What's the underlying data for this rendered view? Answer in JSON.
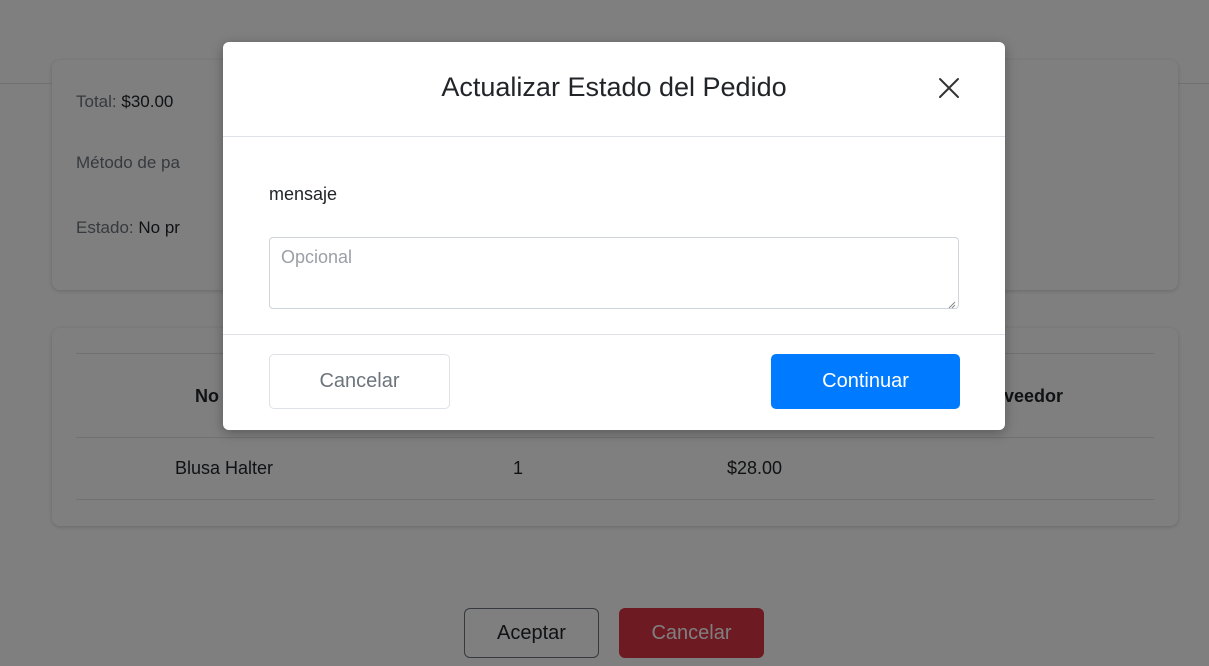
{
  "order_info": {
    "total_label": "Total:",
    "total_value": "$30.00",
    "payment_label": "Método de pa",
    "status_label": "Estado:",
    "status_value": "No pr"
  },
  "products_table": {
    "columns": [
      {
        "label": "No"
      },
      {
        "label": "veedor"
      }
    ],
    "rows": [
      {
        "name": "Blusa Halter",
        "quantity": "1",
        "price": "$28.00"
      }
    ]
  },
  "actions": {
    "accept_label": "Aceptar",
    "cancel_label": "Cancelar"
  },
  "modal": {
    "title": "Actualizar Estado del Pedido",
    "close_icon": "close-icon",
    "message_label": "mensaje",
    "message_placeholder": "Opcional",
    "message_value": "",
    "cancel_label": "Cancelar",
    "continue_label": "Continuar"
  },
  "colors": {
    "primary": "#007bff",
    "danger": "#dc3545",
    "overlay": "rgba(0,0,0,0.5)"
  }
}
